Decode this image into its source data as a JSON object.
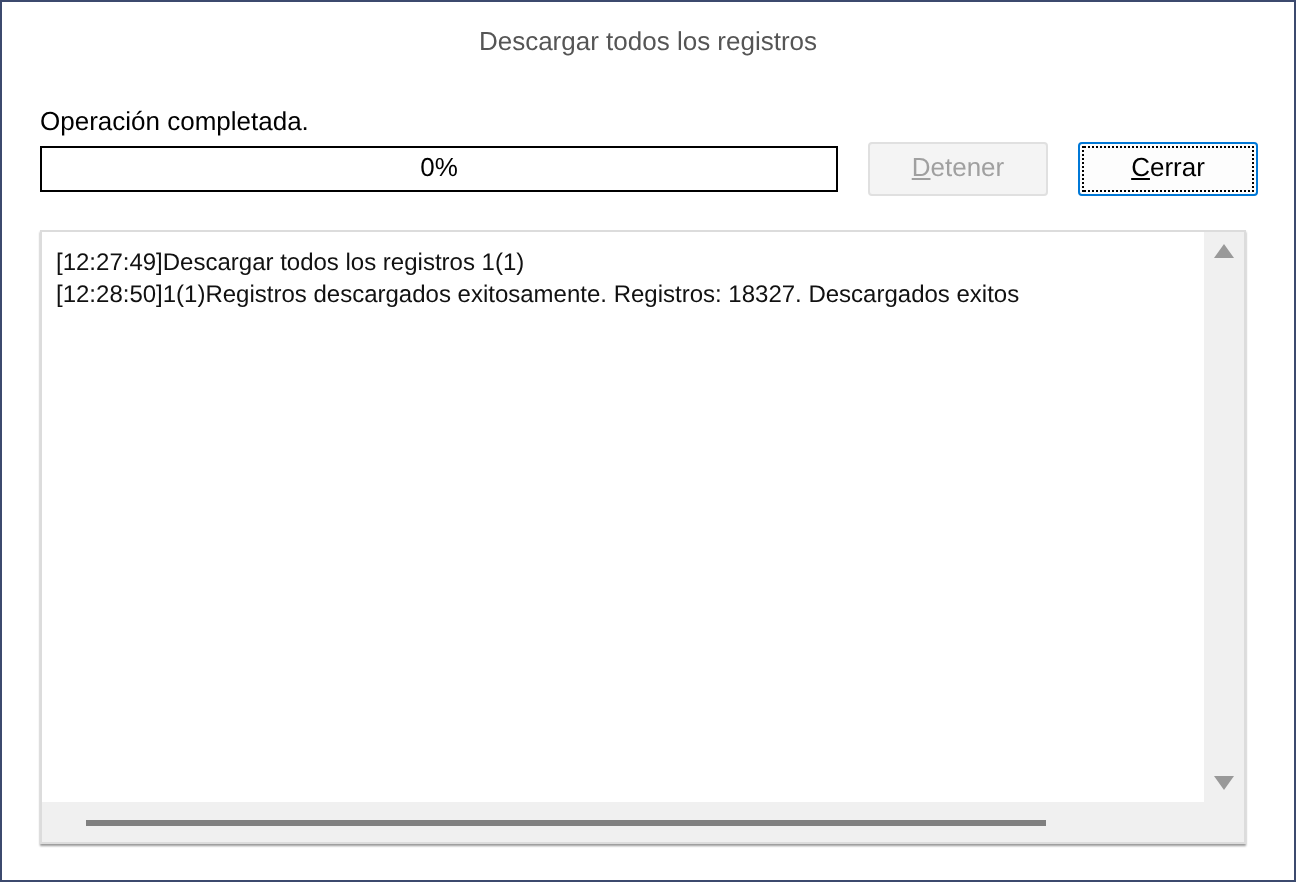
{
  "window": {
    "title": "Descargar todos los registros"
  },
  "status_label": "Operación completada.",
  "progress": {
    "level": 0,
    "reading": "0%"
  },
  "buttons": [
    {
      "label": "Detener",
      "disabled": true,
      "focused": false
    },
    {
      "label": "Cerrar",
      "disabled": false,
      "focused": true
    }
  ],
  "log": [
    "[12:27:49]Descargar todos los registros 1(1)",
    "[12:28:50]1(1)Registros descargados exitosamente. Registros: 18327. Descargados exitos"
  ]
}
